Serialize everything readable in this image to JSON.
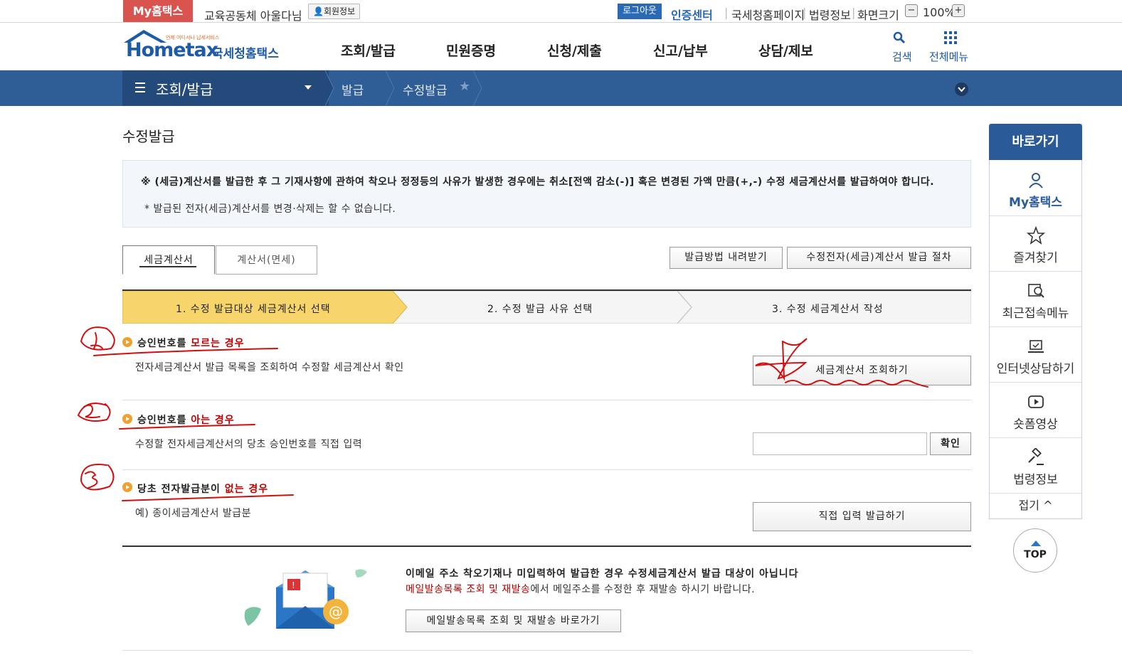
{
  "topbar": {
    "my_hometax": "My홈택스",
    "user_name": "교육공동체 아울다님",
    "member_info": "회원정보",
    "logout": "로그아웃",
    "cert_center": "인증센터",
    "nts_page": "국세청홈페이지",
    "law_info": "법령정보",
    "screen_size": "화면크기",
    "zoom_minus": "−",
    "zoom_value": "100%",
    "zoom_plus": "+"
  },
  "header": {
    "logo_tiny": "언제 어디서나 납세서비스",
    "logo_main": "Hometax",
    "logo_sub": "국세청홈택스",
    "gnb": [
      "조회/발급",
      "민원증명",
      "신청/제출",
      "신고/납부",
      "상담/제보"
    ],
    "search_label": "검색",
    "all_menu_label": "전체메뉴"
  },
  "nav": {
    "current": "조회/발급",
    "crumbs": [
      "발급",
      "수정발급"
    ]
  },
  "main": {
    "page_title": "수정발급",
    "notice_main": "※ (세금)계산서를 발급한 후 그 기재사항에 관하여 착오나 정정등의 사유가 발생한 경우에는 취소[전액 감소(-)] 혹은 변경된 가액 만큼(+,-) 수정 세금계산서를 발급하여야 합니다.",
    "notice_sub": "* 발급된 전자(세금)계산서를 변경·삭제는 할 수 없습니다.",
    "tabs": [
      "세금계산서",
      "계산서(면세)"
    ],
    "download_guide_btn": "발급방법 내려받기",
    "procedure_btn": "수정전자(세금)계산서 발급 절차",
    "steps": [
      "1. 수정 발급대상 세금계산서 선택",
      "2. 수정 발급 사유 선택",
      "3. 수정 세금계산서 작성"
    ],
    "sections": [
      {
        "title_a": "승인번호를 ",
        "title_red": "모르는 경우",
        "desc": "전자세금계산서 발급 목록을 조회하여 수정할 세금계산서 확인",
        "button": "세금계산서 조회하기"
      },
      {
        "title_a": "승인번호를 ",
        "title_red": "아는 경우",
        "desc": "수정할 전자세금계산서의 당초 승인번호를 직접 입력",
        "button": "확인"
      },
      {
        "title_a": "당초 전자발급분이 ",
        "title_red": "없는 경우",
        "desc": "예) 종이세금계산서 발급분",
        "button": "직접 입력 발급하기"
      }
    ],
    "email_title": "이메일 주소 착오기재나 미입력하여 발급한 경우 수정세금계산서 발급 대상이 아닙니다",
    "email_desc_red": "메일발송목록 조회 및 재발송",
    "email_desc_rest": "에서 메일주소를 수정한 후 재발송 하시기 바랍니다.",
    "email_button": "메일발송목록 조회 및 재발송 바로가기"
  },
  "quick_menu": {
    "title": "바로가기",
    "items": [
      "My홈택스",
      "즐겨찾기",
      "최근접속메뉴",
      "인터넷상담하기",
      "숏폼영상",
      "법령정보"
    ],
    "fold": "접기",
    "top": "TOP"
  },
  "colors": {
    "brand_blue": "#2f5d95",
    "step_active": "#f7d56b",
    "annotation_red": "#d01010"
  }
}
